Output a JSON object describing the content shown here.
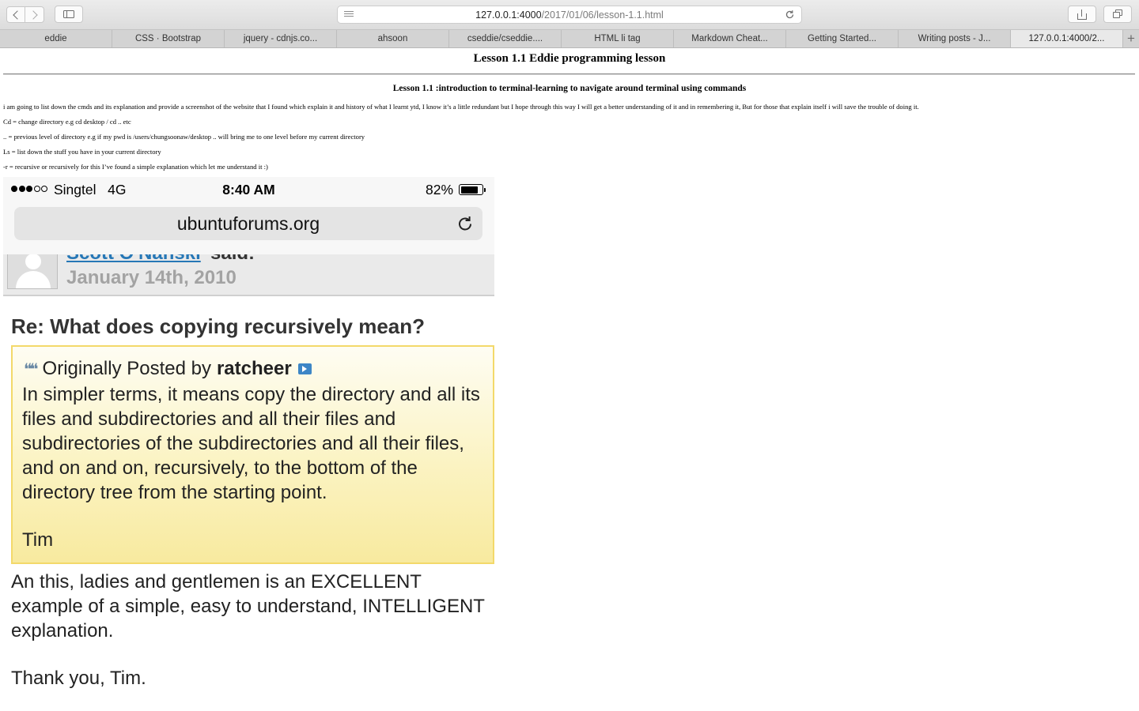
{
  "browser": {
    "url_host": "127.0.0.1:4000",
    "url_path": "/2017/01/06/lesson-1.1.html",
    "tabs": [
      {
        "label": "eddie",
        "active": false
      },
      {
        "label": "CSS · Bootstrap",
        "active": false
      },
      {
        "label": "jquery - cdnjs.co...",
        "active": false
      },
      {
        "label": "ahsoon",
        "active": false
      },
      {
        "label": "cseddie/cseddie....",
        "active": false
      },
      {
        "label": "HTML li tag",
        "active": false
      },
      {
        "label": "Markdown Cheat...",
        "active": false
      },
      {
        "label": "Getting Started...",
        "active": false
      },
      {
        "label": "Writing posts - J...",
        "active": false
      },
      {
        "label": "127.0.0.1:4000/2...",
        "active": true
      }
    ],
    "new_tab_symbol": "+"
  },
  "page": {
    "title": "Lesson 1.1 Eddie programming lesson",
    "section_title": "Lesson 1.1 :introduction to terminal-learning to navigate around terminal using commands",
    "paragraphs": [
      "i am going to list down the cmds and its explanation and provide a screenshot of the website that I found which explain it and history of what I learnt ytd, I know it’s a little redundant but I hope through this way I will get a better understanding of it and in remembering it, But for those that explain itself i will save the trouble of doing it.",
      "Cd = change directory e.g cd desktop / cd .. etc",
      ".. = previous level of directory e.g if my pwd is /users/chungsoonaw/desktop .. will bring me to one level before my current directory",
      "Ls = list down the stuff you have in your current directory",
      "-r = recursive or recursively for this I’ve found a simple explanation which let me understand it :)"
    ]
  },
  "screenshot": {
    "carrier": "Singtel",
    "network": "4G",
    "time": "8:40 AM",
    "battery_percent": "82%",
    "battery_level": 0.82,
    "signal_bars": 3,
    "signal_total": 5,
    "site": "ubuntuforums.org",
    "poster": "Scott O'Nanski",
    "said": "said:",
    "post_date": "January 14th, 2010",
    "post_title": "Re: What does copying recursively mean?",
    "quote_prefix": "Originally Posted by",
    "quote_author": "ratcheer",
    "quote_body": "In simpler terms, it means copy the directory and all its files and subdirectories and all their files and subdirectories of the subdirectories and all their files, and on and on, recursively, to the bottom of the directory tree from the starting point.",
    "quote_signature": "Tim",
    "reply_text": "An this, ladies and gentlemen is an EXCELLENT example of a simple, easy to understand, INTELLIGENT explanation.",
    "thanks_text": "Thank you, Tim."
  },
  "colors": {
    "link": "#2677b6",
    "quote_border": "#f3d96a",
    "quote_bg_bottom": "#f8ea9f",
    "date_gray": "#a3a3a3"
  }
}
